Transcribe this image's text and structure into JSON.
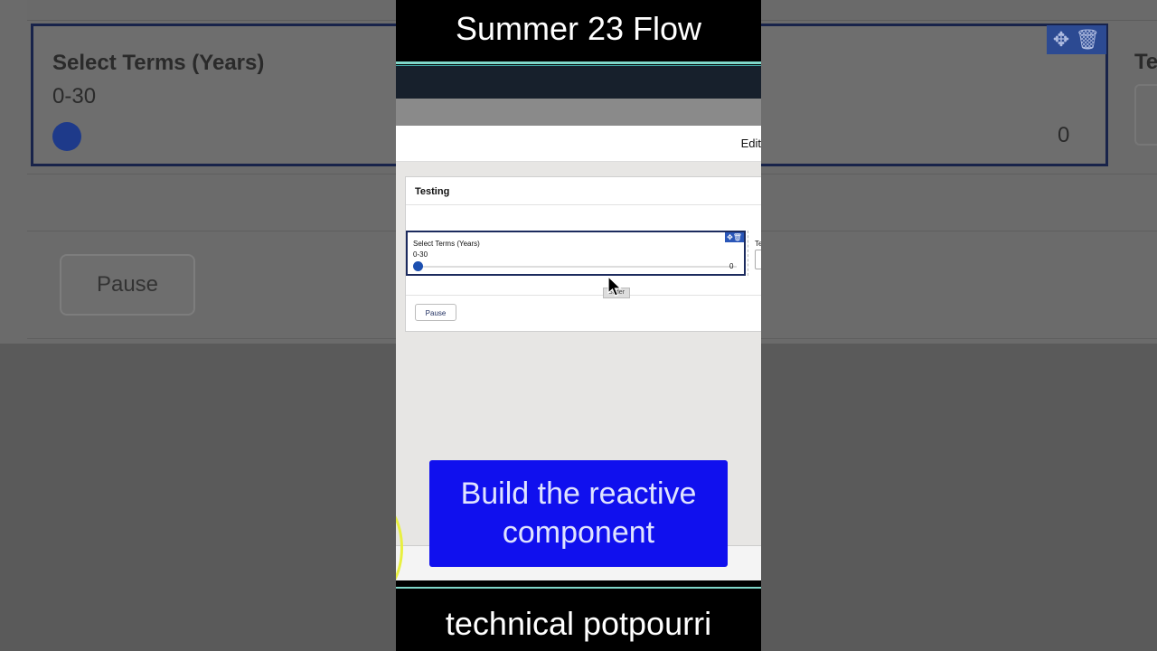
{
  "video": {
    "title": "Summer 23 Flow",
    "channel": "technical potpourri",
    "caption": "Build the reactive component"
  },
  "builder": {
    "edit_label": "Edit",
    "screen_title": "Testing",
    "component": {
      "label": "Select Terms (Years)",
      "range": "0-30",
      "value": "0",
      "tools_icons": [
        "move-icon",
        "trash-icon"
      ]
    },
    "side_label": "Te",
    "pause_label": "Pause",
    "tooltip": "Slider"
  },
  "colors": {
    "caption_bg": "#1010ee",
    "accent": "#1c4fb0",
    "teal": "#7fd6c8"
  }
}
